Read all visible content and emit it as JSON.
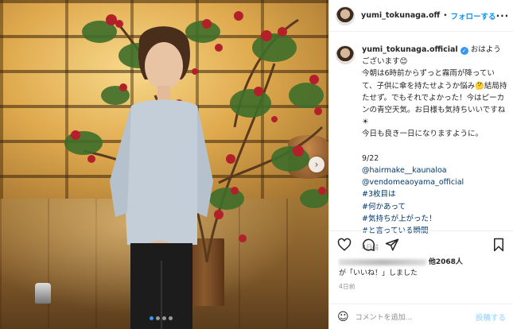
{
  "post": {
    "username": "yumi_tokunaga.official",
    "header_username_display": "yumi_tokunaga.off",
    "follow_separator": "•",
    "follow_label": "フォローする",
    "more_icon": "more-icon",
    "caption_lines": [
      "おはようございます😊",
      "今朝は6時前からずっと霧雨が降っていて、子供に傘を持たせようか悩み🤔結局持たせず。でもそれでよかった！今はピーカンの青空天気。お日様も気持ちいいですね☀",
      "今日も良き一日になりますように。"
    ],
    "date_line": "9/22",
    "mentions": [
      "@hairmake__kaunaloa",
      "@vendomeaoyama_official"
    ],
    "hashtags": [
      "#3枚目は",
      "#何かあって",
      "#気持ちが上がった！",
      "#と言っている瞬間"
    ],
    "caption_time": "4日前",
    "likes_suffix": "他2068人",
    "likes_line2": "が「いいね！」しました",
    "post_time": "4日前",
    "comment_placeholder": "コメントを追加...",
    "post_button": "投稿する",
    "carousel": {
      "total": 4,
      "active_index": 0
    },
    "colors": {
      "follow": "#0095f6",
      "verified": "#3897f0",
      "link": "#00376b",
      "muted": "#8e8e8e"
    }
  }
}
